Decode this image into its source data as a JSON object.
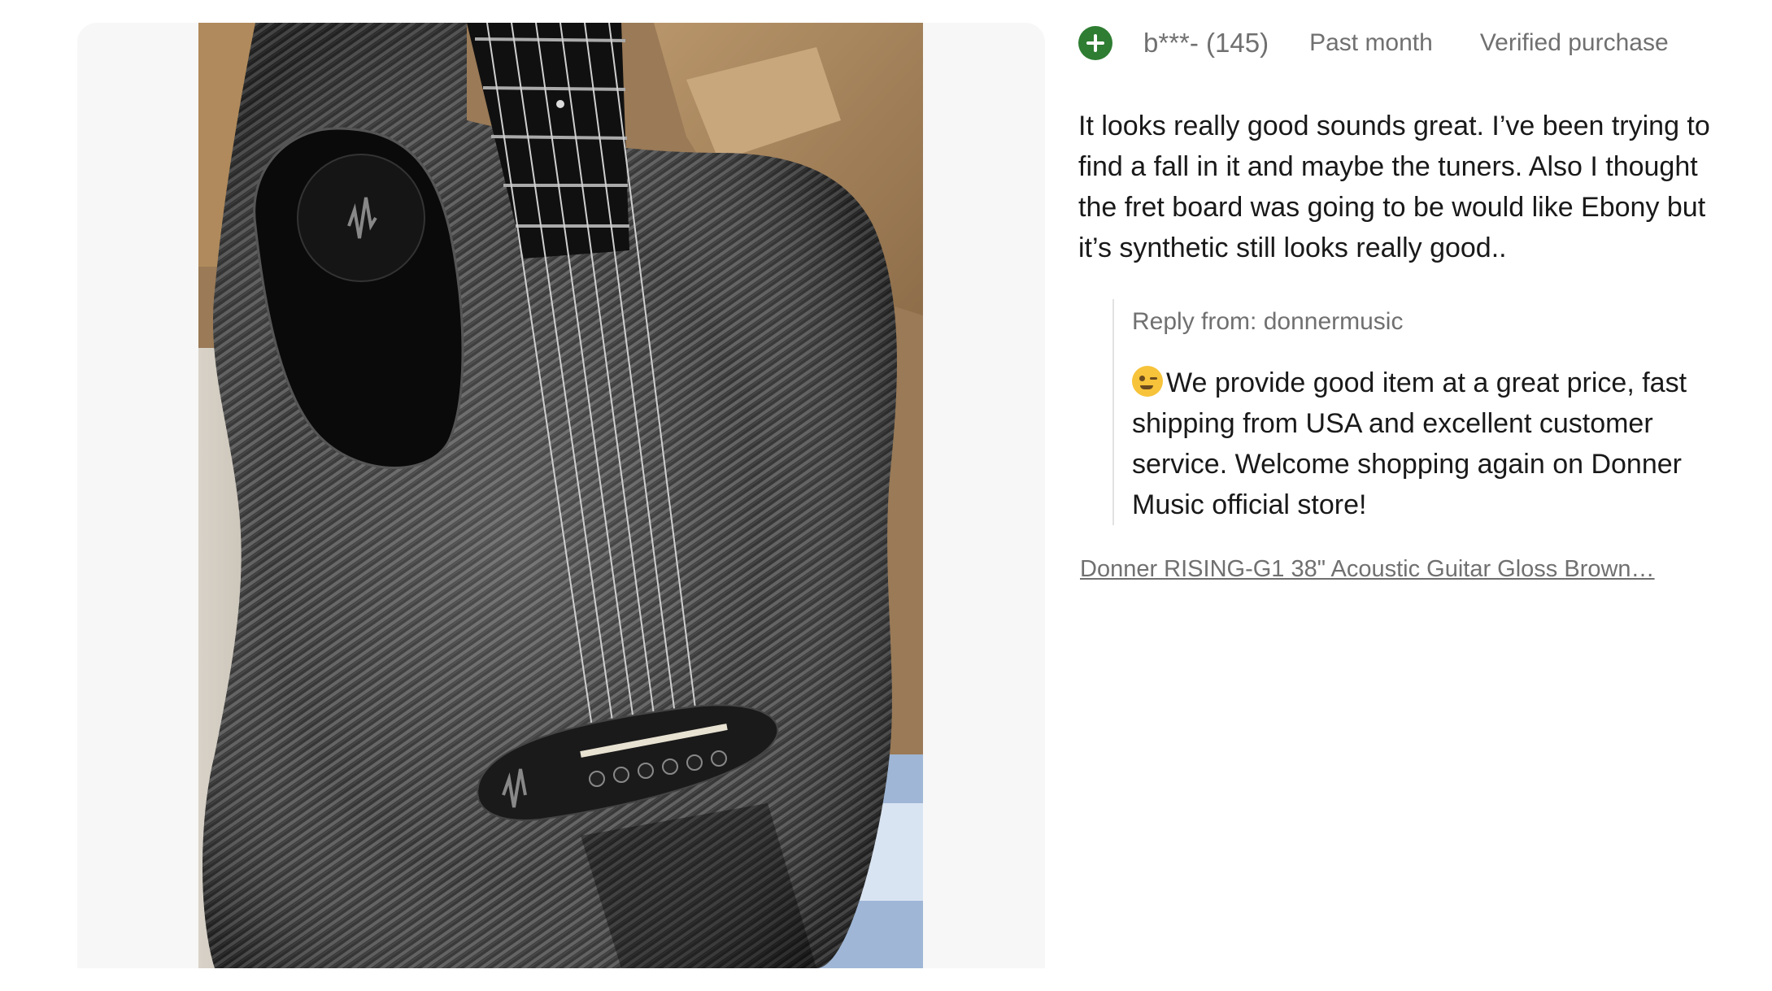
{
  "review": {
    "reviewer": "b***- (145)",
    "date": "Past month",
    "verified": "Verified purchase",
    "text": "It looks really good sounds great. I’ve been trying to find a fall in it and maybe the tuners. Also I thought the fret board was going to be would like Ebony but it’s synthetic still looks really good..",
    "reply": {
      "from": "Reply from: donnermusic",
      "text": "We provide good item at a great price, fast shipping from USA and excellent customer service. Welcome shopping again on Donner Music official store!"
    },
    "product_link": "Donner RISING-G1 38\" Acoustic Guitar Gloss Brown…"
  },
  "colors": {
    "avatar": "#2e7d32",
    "meta_text": "#707070",
    "body_text": "#191919",
    "panel_bg": "#f7f7f7"
  },
  "icons": {
    "avatar": "plus-icon",
    "reply_emoji": "winking-face-icon"
  }
}
